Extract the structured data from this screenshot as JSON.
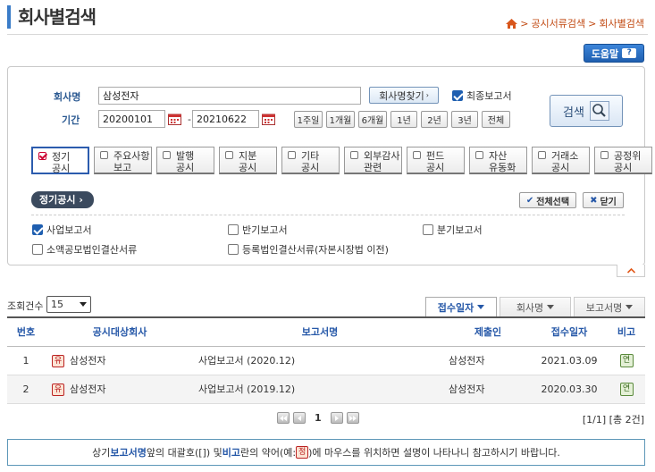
{
  "header": {
    "title": "회사별검색",
    "breadcrumb": [
      "공시서류검색",
      "회사별검색"
    ],
    "help_label": "도움말"
  },
  "search": {
    "company_label": "회사명",
    "company_value": "삼성전자",
    "find_company_label": "회사명찾기",
    "final_report_label": "최종보고서",
    "final_report_checked": true,
    "period_label": "기간",
    "start_date": "20200101",
    "end_date": "20210622",
    "period_buttons": [
      "1주일",
      "1개월",
      "6개월",
      "1년",
      "2년",
      "3년",
      "전체"
    ],
    "search_button_label": "검색"
  },
  "categories": [
    {
      "line1": "정기",
      "line2": "공시",
      "selected": true
    },
    {
      "line1": "주요사항",
      "line2": "보고",
      "selected": false
    },
    {
      "line1": "발행",
      "line2": "공시",
      "selected": false
    },
    {
      "line1": "지분",
      "line2": "공시",
      "selected": false
    },
    {
      "line1": "기타",
      "line2": "공시",
      "selected": false
    },
    {
      "line1": "외부감사",
      "line2": "관련",
      "selected": false
    },
    {
      "line1": "펀드",
      "line2": "공시",
      "selected": false
    },
    {
      "line1": "자산",
      "line2": "유동화",
      "selected": false
    },
    {
      "line1": "거래소",
      "line2": "공시",
      "selected": false
    },
    {
      "line1": "공정위",
      "line2": "공시",
      "selected": false
    }
  ],
  "sub_panel": {
    "tab_label": "정기공시",
    "select_all_label": "전체선택",
    "close_label": "닫기",
    "reports": [
      {
        "label": "사업보고서",
        "checked": true
      },
      {
        "label": "반기보고서",
        "checked": false
      },
      {
        "label": "분기보고서",
        "checked": false
      },
      {
        "label": "소액공모법인결산서류",
        "checked": false
      },
      {
        "label": "등록법인결산서류(자본시장법 이전)",
        "checked": false
      }
    ]
  },
  "results": {
    "count_label": "조회건수",
    "count_value": "15",
    "sort_tabs": [
      "접수일자",
      "회사명",
      "보고서명"
    ],
    "columns": [
      "번호",
      "공시대상회사",
      "보고서명",
      "제출인",
      "접수일자",
      "비고"
    ],
    "rows": [
      {
        "no": "1",
        "badge": "유",
        "company": "삼성전자",
        "report": "사업보고서 (2020.12)",
        "submitter": "삼성전자",
        "date": "2021.03.09",
        "note": "연"
      },
      {
        "no": "2",
        "badge": "유",
        "company": "삼성전자",
        "report": "사업보고서 (2019.12)",
        "submitter": "삼성전자",
        "date": "2020.03.30",
        "note": "연"
      }
    ],
    "current_page": "1",
    "page_info": "[1/1] [총 2건]"
  },
  "notice": {
    "part1": "상기 ",
    "hl1": "보고서명",
    "part2": " 앞의 대괄호([]) 및 ",
    "hl2": "비고",
    "part3": "란의 약어(예:",
    "badge": "정",
    "part4": ")에 마우스를 위치하면 설명이 나타나니 참고하시기 바랍니다."
  },
  "colors": {
    "accent": "#2658a8",
    "breadcrumb": "#c24b14",
    "title_bar": "#3a7cc8"
  }
}
